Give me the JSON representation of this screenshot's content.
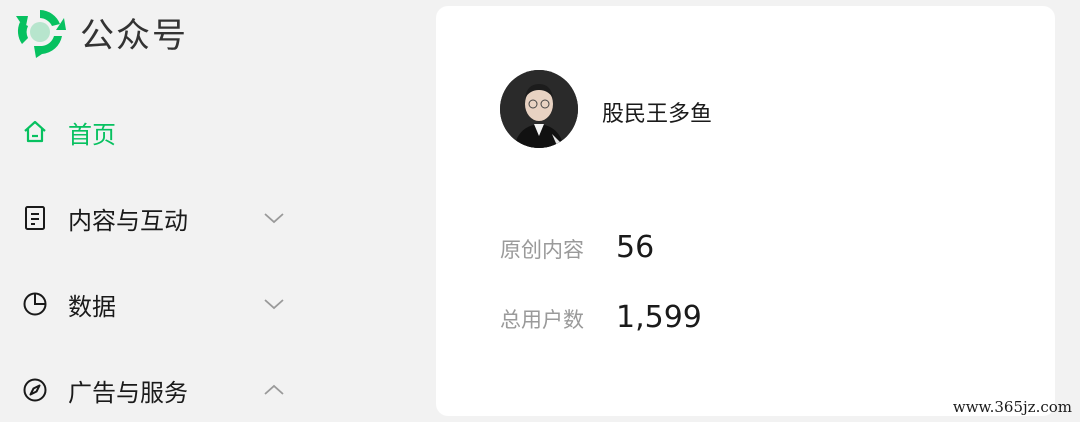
{
  "brand": {
    "title": "公众号",
    "logo_icon": "wechat-official-account-logo",
    "accent": "#07c160"
  },
  "nav": {
    "items": [
      {
        "label": "首页",
        "icon": "home-icon",
        "active": true
      },
      {
        "label": "内容与互动",
        "icon": "document-icon",
        "chevron": "down"
      },
      {
        "label": "数据",
        "icon": "pie-chart-icon",
        "chevron": "down"
      },
      {
        "label": "广告与服务",
        "icon": "compass-icon",
        "chevron": "up"
      }
    ]
  },
  "account": {
    "name": "股民王多鱼",
    "stats": [
      {
        "label": "原创内容",
        "value": "56"
      },
      {
        "label": "总用户数",
        "value": "1,599"
      }
    ]
  },
  "watermark": "www.365jz.com"
}
